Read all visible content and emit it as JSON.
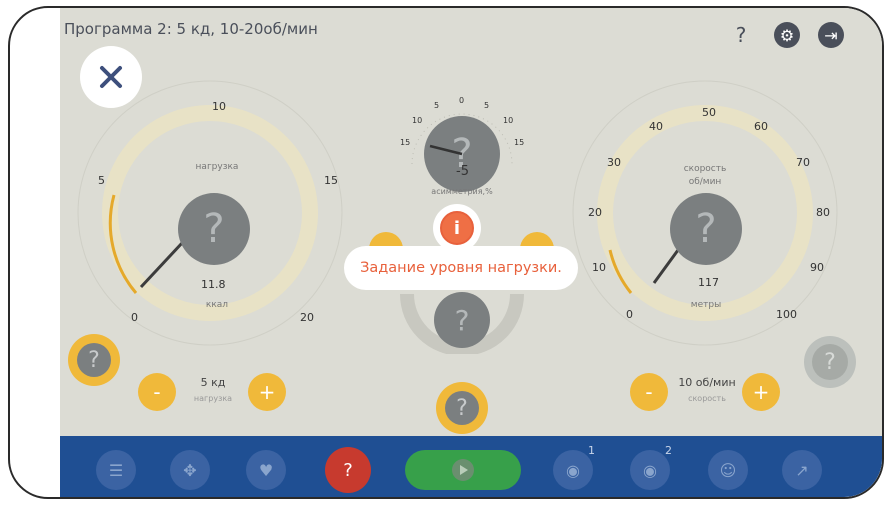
{
  "header": {
    "title": "Программа 2: 5 кд, 10-20об/мин",
    "help_icon": "question-icon",
    "settings_icon": "gear-icon",
    "exit_icon": "exit-icon"
  },
  "close_button": {
    "icon": "close-icon"
  },
  "left_gauge": {
    "ticks": [
      "0",
      "5",
      "10",
      "15",
      "20"
    ],
    "top_label": "нагрузка",
    "value": "11.8",
    "unit": "ккал"
  },
  "center_gauge": {
    "ticks": [
      "15",
      "10",
      "5",
      "0",
      "5",
      "10",
      "15"
    ],
    "value": "-5",
    "label": "асимметрия,%"
  },
  "right_gauge": {
    "ticks": [
      "0",
      "10",
      "20",
      "30",
      "40",
      "50",
      "60",
      "70",
      "80",
      "90",
      "100"
    ],
    "top_label": "скорость",
    "top_label_2": "об/мин",
    "value": "117",
    "unit": "метры"
  },
  "left_stepper": {
    "minus": "-",
    "plus": "+",
    "value": "5 кд",
    "sub": "нагрузка"
  },
  "right_stepper": {
    "minus": "-",
    "plus": "+",
    "value": "10 об/мин",
    "sub": "скорость"
  },
  "question_mark": "?",
  "tooltip": {
    "icon": "info-icon",
    "icon_text": "i",
    "text": "Задание уровня нагрузки."
  },
  "bottom_bar": {
    "buttons": [
      {
        "icon": "sliders-icon"
      },
      {
        "icon": "arrows-icon"
      },
      {
        "icon": "heart-icon"
      },
      {
        "icon": "help-icon"
      },
      {
        "icon": "play-icon"
      },
      {
        "icon": "eye-icon",
        "badge": "1"
      },
      {
        "icon": "eye-icon",
        "badge": "2"
      },
      {
        "icon": "head-icon"
      },
      {
        "icon": "chart-icon"
      }
    ]
  },
  "colors": {
    "accent_orange": "#e8613c",
    "gauge_yellow": "#f0b93a",
    "bottom_bar_blue": "#1f4f93",
    "play_green": "#37a04a",
    "stop_red": "#c73a2e"
  }
}
